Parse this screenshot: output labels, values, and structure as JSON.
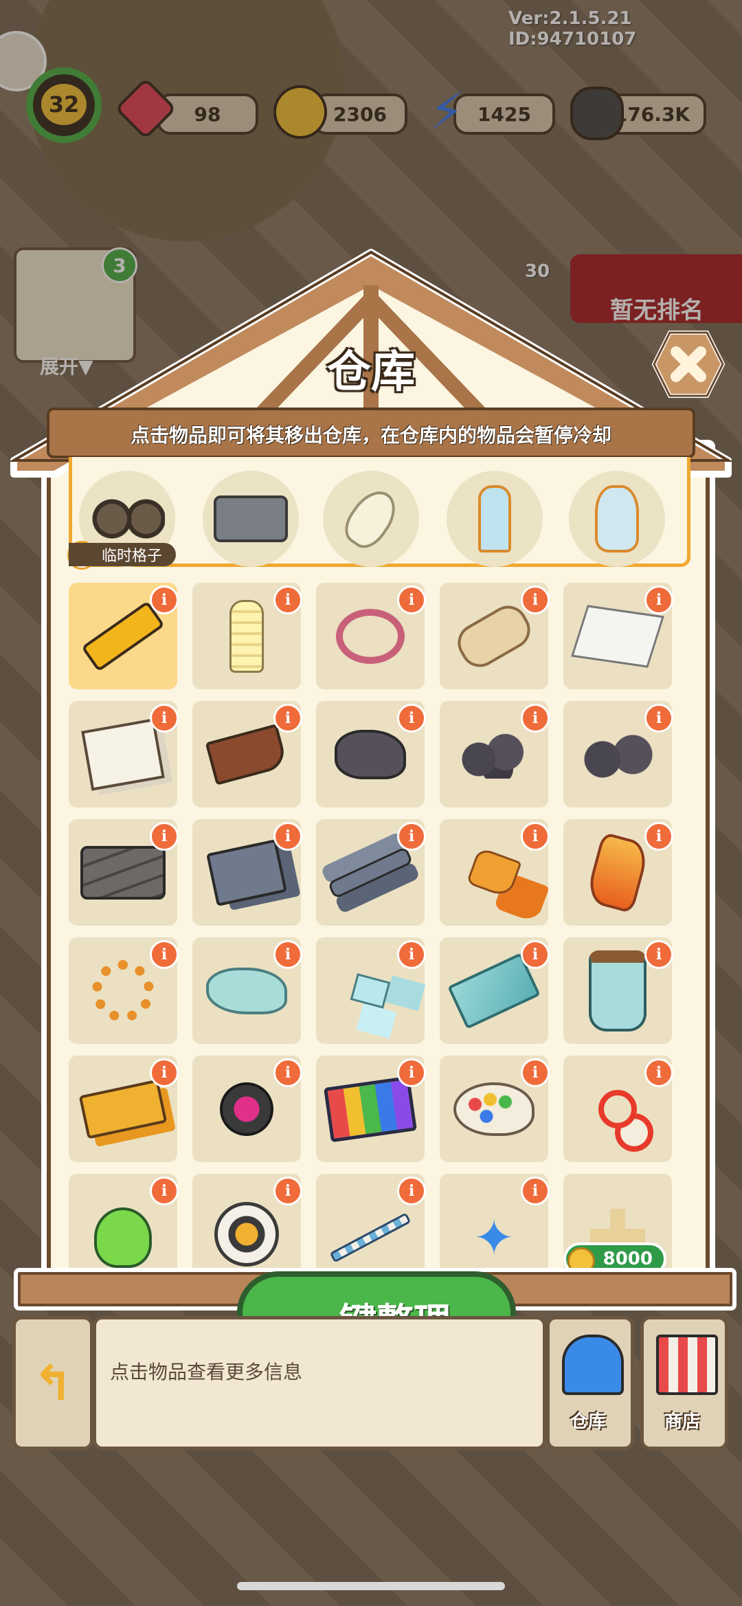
{
  "version": "Ver:2.1.5.21 ID:94710107",
  "hud": {
    "level": "32",
    "gems": "98",
    "coins": "2306",
    "energy": "1425",
    "seeds": "176.3K"
  },
  "side": {
    "badge_count": "3",
    "expand_label": "展开▼",
    "event_count": "30",
    "rank_label": "暂无排名"
  },
  "warehouse": {
    "title": "仓库",
    "hint": "点击物品即可将其移出仓库，在仓库内的物品会暂停冷却",
    "temp_label": "临时格子",
    "temp_items": [
      "wheels-icon",
      "cart-icon",
      "bulb-icon",
      "lamp-icon",
      "potion-lamp-icon"
    ],
    "grid": [
      [
        "flashlight",
        "cfl-bulb",
        "rubber-band",
        "scroll",
        "paper-sheet"
      ],
      [
        "photos",
        "wheelbarrow",
        "rock",
        "coal-pile",
        "ore-pile"
      ],
      [
        "iron-bars",
        "metal-plates",
        "metal-rods",
        "amber-shards",
        "amber-gem"
      ],
      [
        "bead-bracelet",
        "glitter-pile",
        "glass-shards",
        "glass-pane",
        "glass-jar"
      ],
      [
        "tickets",
        "stage-light",
        "paint-box",
        "palette",
        "scissors"
      ],
      [
        "green-potion",
        "pocket-watch",
        "magic-wand",
        "blue-star",
        "add-slot"
      ]
    ],
    "add_slot_price": "8000",
    "sort_button": "一键整理"
  },
  "bottom": {
    "info_text": "点击物品查看更多信息",
    "nav_warehouse": "仓库",
    "nav_shop": "商店"
  },
  "colors": {
    "accent_orange": "#ef6b3a",
    "button_green": "#4bb64a",
    "roof_brown": "#b9855a"
  }
}
